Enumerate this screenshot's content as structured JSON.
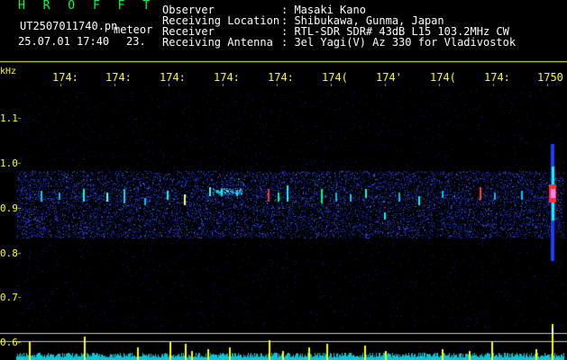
{
  "header": {
    "app_name": "H R O F F T",
    "filename": "UT2507011740.pn",
    "mode": "meteor",
    "datetime": "25.07.01 17:40",
    "count": "23.",
    "info_labels": [
      "Observer",
      "Receiving Location",
      "Receiver",
      "Receiving Antenna"
    ],
    "info_values": [
      ": Masaki Kano",
      ": Shibukawa, Gunma, Japan",
      ": RTL-SDR SDR# 43dB L15 103.2MHz CW",
      ": 3el Yagi(V) Az 330 for Vladivostok"
    ]
  },
  "axes": {
    "y_unit": "kHz",
    "y_ticks": [
      "1.1",
      "1.0",
      "0.9",
      "0.8",
      "0.7",
      "0.6"
    ],
    "x_ticks": [
      "174:",
      "174:",
      "174:",
      "174:",
      "174:",
      "174(",
      "174'",
      "174(",
      "174:",
      "1750"
    ]
  },
  "colors": {
    "background": "#000000",
    "text_white": "#ffffff",
    "text_yellow": "#ffff00",
    "hrofft_green": "#00ff44",
    "noise_blue": "#1a2fd8",
    "echo_cyan": "#00ffff",
    "echo_red": "#ff3030"
  }
}
